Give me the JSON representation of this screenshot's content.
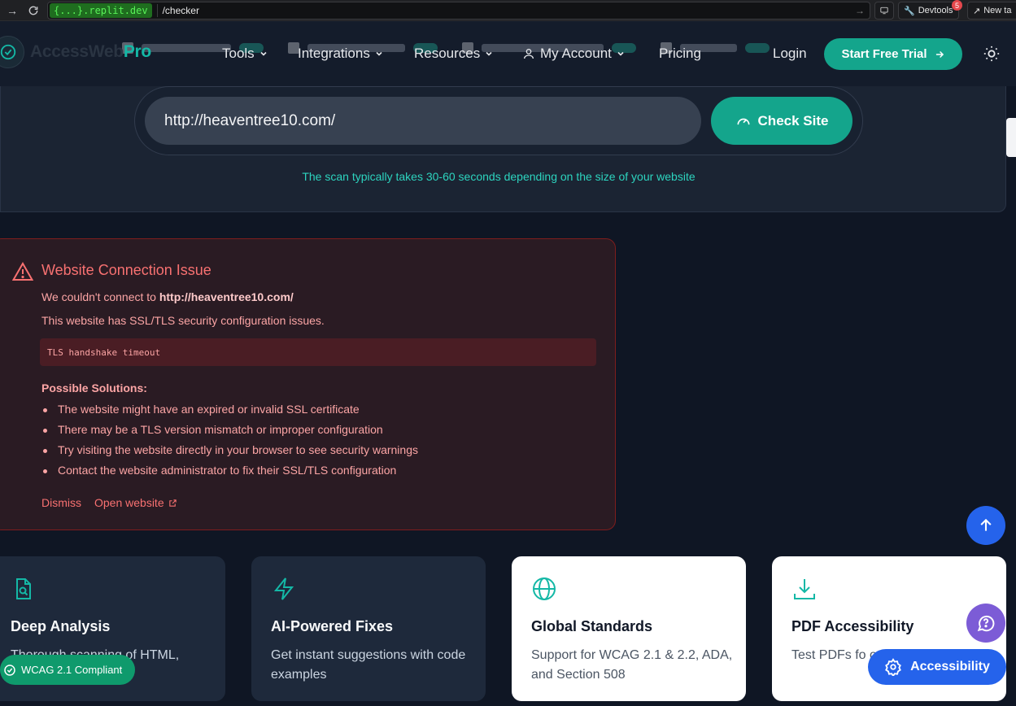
{
  "browser": {
    "url_host": "{...}.replit.dev",
    "url_path": "/checker",
    "devtools_label": "Devtools",
    "devtools_badge": "5",
    "new_tab_label": "New ta"
  },
  "header": {
    "logo_text": "AccessWeb",
    "logo_accent": "Pro",
    "nav": [
      {
        "label": "Tools"
      },
      {
        "label": "Integrations"
      },
      {
        "label": "Resources"
      },
      {
        "label": "My Account"
      },
      {
        "label": "Pricing"
      }
    ],
    "login_label": "Login",
    "trial_label": "Start Free Trial"
  },
  "search": {
    "value": "http://heaventree10.com/",
    "button_label": "Check Site",
    "note": "The scan typically takes 30-60 seconds depending on the size of your website"
  },
  "error": {
    "title": "Website Connection Issue",
    "line1_prefix": "We couldn't connect to ",
    "line1_url": "http://heaventree10.com/",
    "line2": "This website has SSL/TLS security configuration issues.",
    "code": "TLS handshake timeout",
    "solutions_title": "Possible Solutions:",
    "solutions": [
      "The website might have an expired or invalid SSL certificate",
      "There may be a TLS version mismatch or improper configuration",
      "Try visiting the website directly in your browser to see security warnings",
      "Contact the website administrator to fix their SSL/TLS configuration"
    ],
    "dismiss_label": "Dismiss",
    "open_label": "Open website"
  },
  "features": [
    {
      "title": "Deep Analysis",
      "desc": "Thorough scanning of HTML, content",
      "icon": "file-search-icon"
    },
    {
      "title": "AI-Powered Fixes",
      "desc": "Get instant suggestions with code examples",
      "icon": "bolt-icon"
    },
    {
      "title": "Global Standards",
      "desc": "Support for WCAG 2.1 & 2.2, ADA, and Section 508",
      "icon": "globe-icon"
    },
    {
      "title": "PDF Accessibility",
      "desc": "Test PDFs fo order, and d",
      "icon": "download-icon"
    }
  ],
  "floating": {
    "accessibility_label": "Accessibility",
    "wcag_label": "WCAG 2.1 Compliant"
  },
  "colors": {
    "accent": "#14a58c",
    "error": "#f87171",
    "fab_blue": "#2563eb",
    "fab_purple": "#7c5cd6"
  }
}
